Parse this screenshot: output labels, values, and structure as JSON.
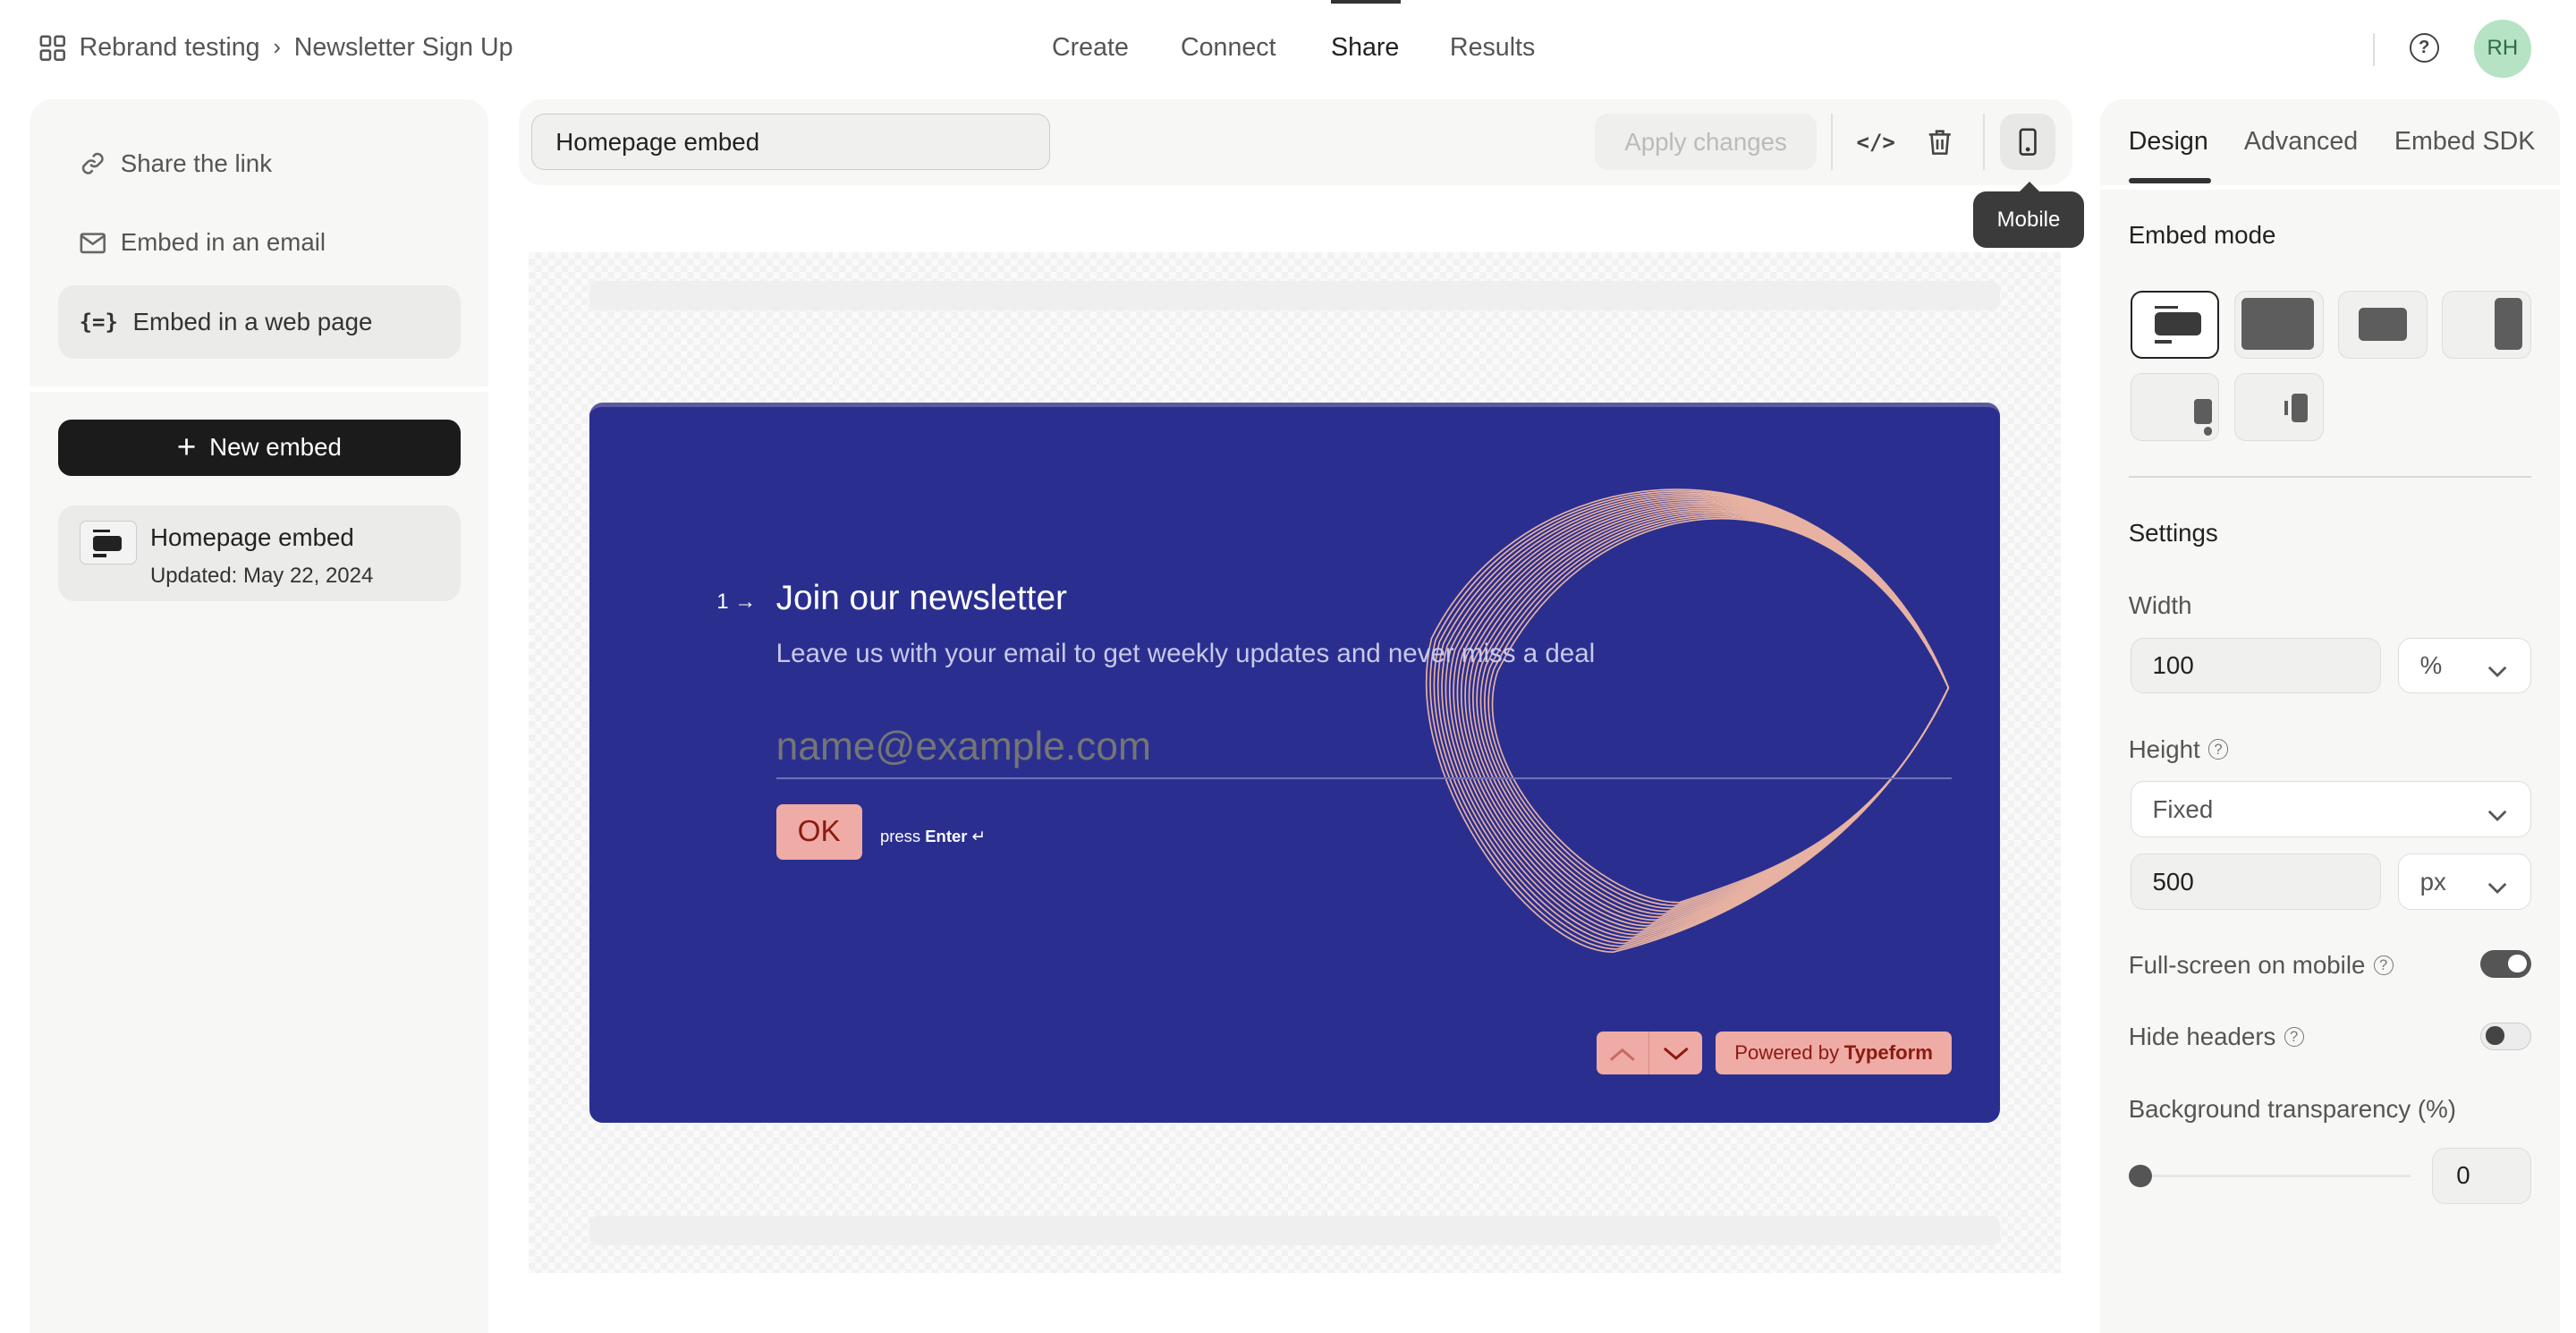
{
  "breadcrumb": {
    "workspace": "Rebrand testing",
    "form": "Newsletter Sign Up"
  },
  "nav": {
    "items": [
      {
        "label": "Create"
      },
      {
        "label": "Connect"
      },
      {
        "label": "Share",
        "active": true
      },
      {
        "label": "Results"
      }
    ]
  },
  "user": {
    "initials": "RH",
    "avatar_color": "#b5e3c4"
  },
  "sidebar": {
    "items": [
      {
        "label": "Share the link",
        "icon": "link-icon"
      },
      {
        "label": "Embed in an email",
        "icon": "mail-icon"
      },
      {
        "label": "Embed in a web page",
        "icon": "code-braces-icon",
        "active": true
      }
    ],
    "new_embed": "New embed",
    "embeds": [
      {
        "name": "Homepage embed",
        "updated": "Updated: May 22, 2024"
      }
    ]
  },
  "toolbar": {
    "embed_name": "Homepage embed",
    "apply": "Apply changes",
    "tooltip": "Mobile"
  },
  "form": {
    "number": "1",
    "title": "Join our newsletter",
    "subtitle": "Leave us with your email to get weekly updates and never miss a deal",
    "placeholder": "name@example.com",
    "ok": "OK",
    "press": "press",
    "enter": "Enter",
    "powered": "Powered by",
    "brand": "Typeform",
    "bg_color": "#2a2f8f",
    "accent": "#efaba5"
  },
  "panel": {
    "tabs": [
      {
        "label": "Design",
        "active": true
      },
      {
        "label": "Advanced"
      },
      {
        "label": "Embed SDK"
      }
    ],
    "embed_mode": "Embed mode",
    "settings": "Settings",
    "width_label": "Width",
    "width": "100",
    "width_unit": "%",
    "height_label": "Height",
    "height_mode": "Fixed",
    "height": "500",
    "height_unit": "px",
    "fullscreen_label": "Full-screen on mobile",
    "fullscreen": true,
    "hide_headers_label": "Hide headers",
    "hide_headers": false,
    "transparency_label": "Background transparency (%)",
    "transparency": "0"
  }
}
